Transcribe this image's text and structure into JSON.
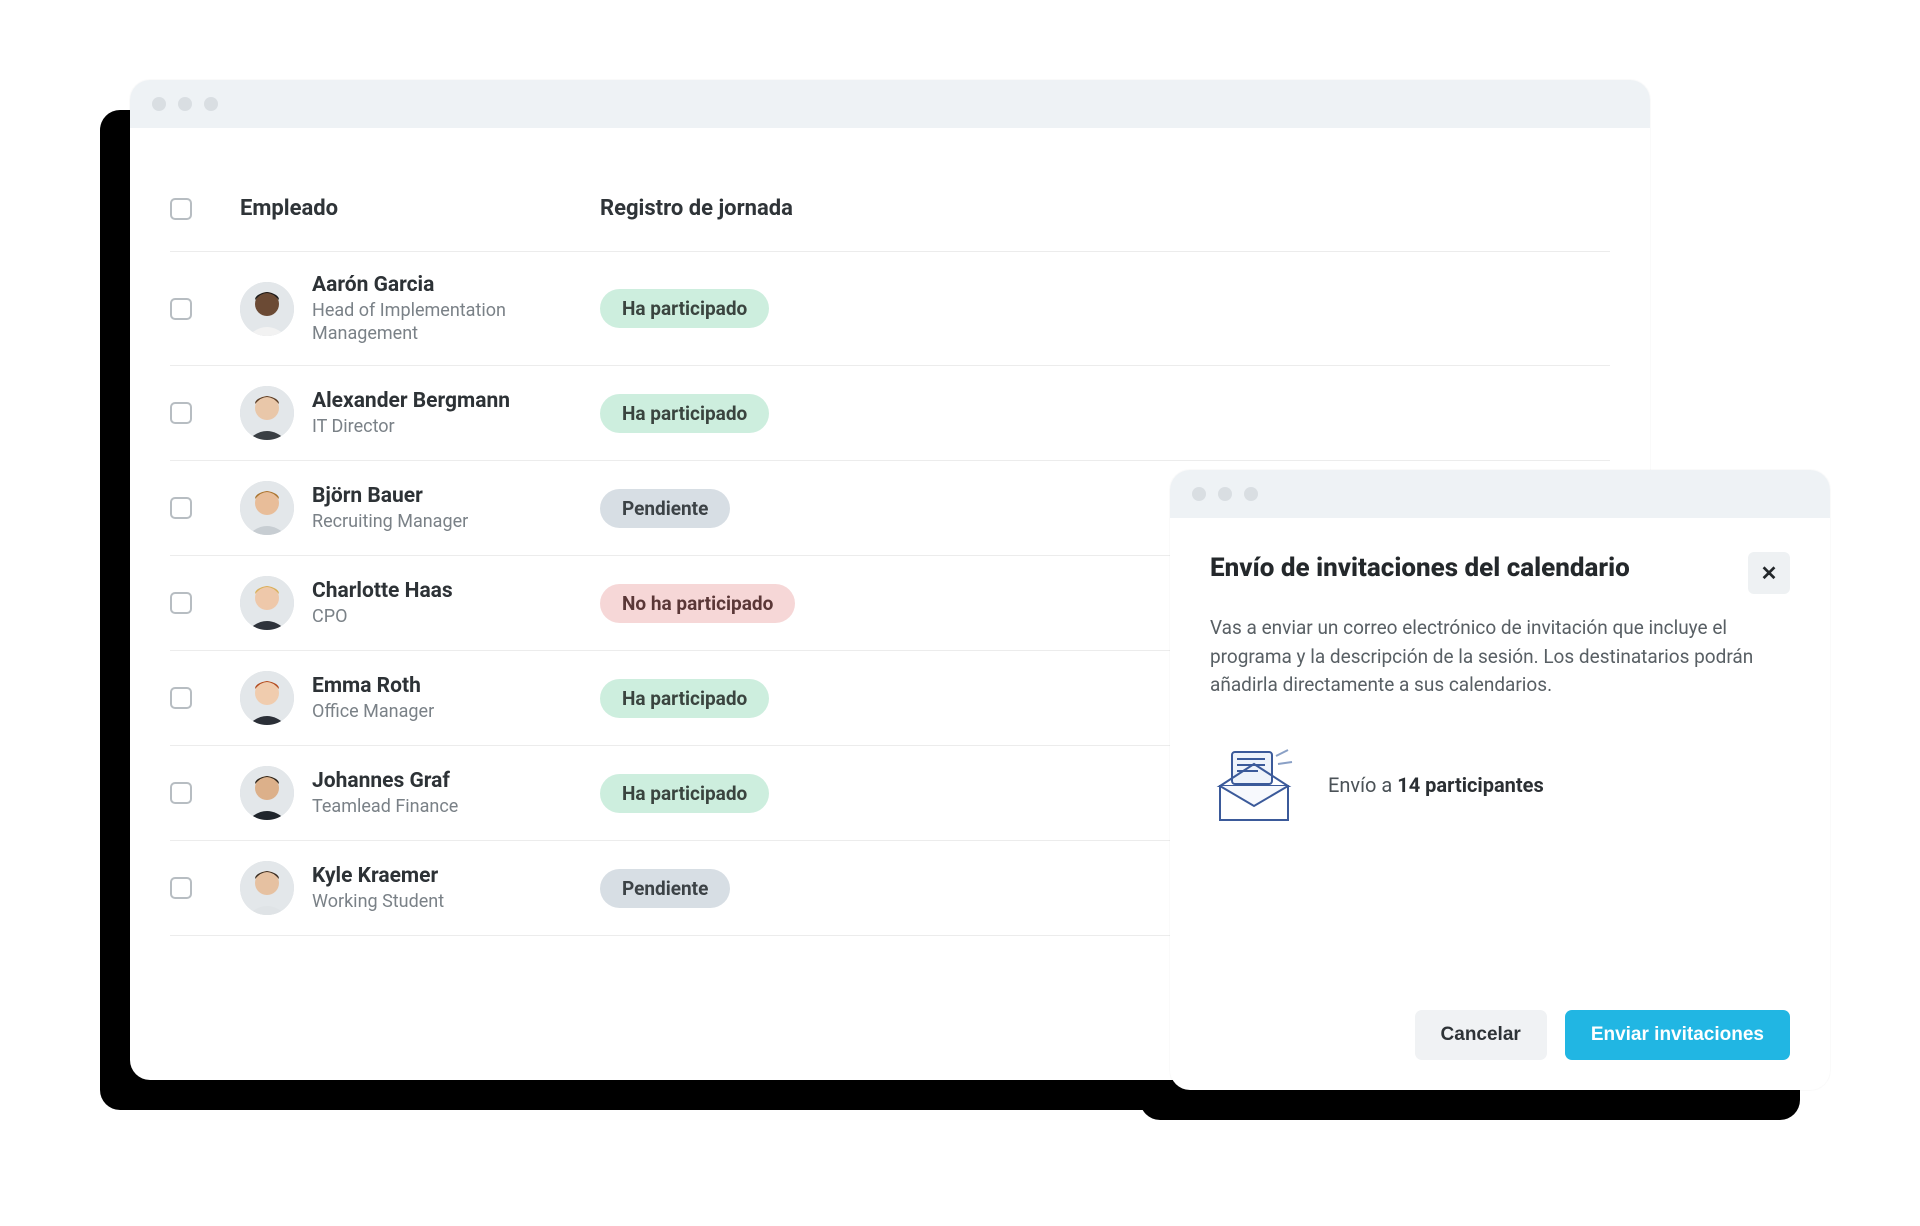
{
  "table": {
    "headers": {
      "employee": "Empleado",
      "status": "Registro de jornada"
    },
    "statuses": {
      "participated": "Ha participado",
      "pending": "Pendiente",
      "not_participated": "No ha participado"
    },
    "rows": [
      {
        "name": "Aarón Garcia",
        "role": "Head of Implementation Management",
        "status": "participated",
        "avatar": "m1"
      },
      {
        "name": "Alexander Bergmann",
        "role": "IT Director",
        "status": "participated",
        "avatar": "m2"
      },
      {
        "name": "Björn Bauer",
        "role": "Recruiting Manager",
        "status": "pending",
        "avatar": "m3"
      },
      {
        "name": "Charlotte Haas",
        "role": "CPO",
        "status": "not_participated",
        "avatar": "f1"
      },
      {
        "name": "Emma Roth",
        "role": "Office Manager",
        "status": "participated",
        "avatar": "f2"
      },
      {
        "name": "Johannes Graf",
        "role": "Teamlead Finance",
        "status": "participated",
        "avatar": "m4"
      },
      {
        "name": "Kyle Kraemer",
        "role": "Working Student",
        "status": "pending",
        "avatar": "m5"
      }
    ]
  },
  "modal": {
    "title": "Envío de invitaciones del calendario",
    "description": "Vas a enviar un correo electrónico de invitación que incluye el programa y la descripción de la sesión. Los destinatarios podrán añadirla directamente a sus calendarios.",
    "send_prefix": "Envío a ",
    "send_count": "14 participantes",
    "close_glyph": "✕",
    "buttons": {
      "cancel": "Cancelar",
      "send": "Enviar invitaciones"
    }
  },
  "avatars": {
    "m1": {
      "skin": "#6b4a34",
      "hair": "#1a1a1a",
      "shirt": "#f2f2f2"
    },
    "m2": {
      "skin": "#e9c7a9",
      "hair": "#5a3c24",
      "shirt": "#3a3f44"
    },
    "m3": {
      "skin": "#e8bd99",
      "hair": "#a9742f",
      "shirt": "#c7cdd2"
    },
    "f1": {
      "skin": "#eec8aa",
      "hair": "#d9b05a",
      "shirt": "#2e333b"
    },
    "f2": {
      "skin": "#f0ccae",
      "hair": "#b24a1e",
      "shirt": "#2b2f37"
    },
    "m4": {
      "skin": "#dcb08a",
      "hair": "#2b2218",
      "shirt": "#1f252c"
    },
    "m5": {
      "skin": "#e6c1a1",
      "hair": "#3a2c20",
      "shirt": "#dfe3e6"
    }
  }
}
